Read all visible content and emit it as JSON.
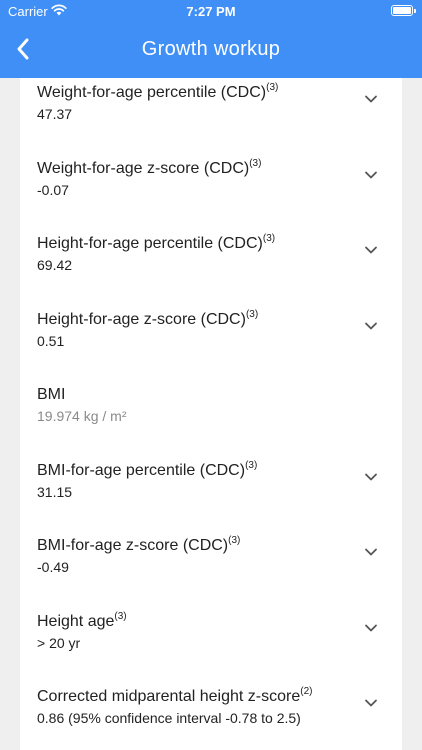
{
  "status_bar": {
    "carrier": "Carrier",
    "time": "7:27 PM",
    "icons": [
      "wifi-icon",
      "battery-icon"
    ]
  },
  "nav": {
    "title": "Growth workup",
    "back_icon": "chevron-left-icon"
  },
  "colors": {
    "header": "#3f8ff7",
    "background": "#efefef",
    "card": "#ffffff"
  },
  "rows": [
    {
      "label": "Weight-for-age percentile (CDC)",
      "ref": "(3)",
      "value": "47.37",
      "expandable": true
    },
    {
      "label": "Weight-for-age z-score (CDC)",
      "ref": "(3)",
      "value": "-0.07",
      "expandable": true
    },
    {
      "label": "Height-for-age percentile (CDC)",
      "ref": "(3)",
      "value": "69.42",
      "expandable": true
    },
    {
      "label": "Height-for-age z-score (CDC)",
      "ref": "(3)",
      "value": "0.51",
      "expandable": true
    },
    {
      "label": "BMI",
      "ref": "",
      "value": "19.974 kg / m²",
      "expandable": false
    },
    {
      "label": "BMI-for-age percentile (CDC)",
      "ref": "(3)",
      "value": "31.15",
      "expandable": true
    },
    {
      "label": "BMI-for-age z-score (CDC)",
      "ref": "(3)",
      "value": "-0.49",
      "expandable": true
    },
    {
      "label": "Height age",
      "ref": "(3)",
      "value": "> 20 yr",
      "expandable": true
    },
    {
      "label": "Corrected midparental height z-score",
      "ref": "(2)",
      "value": "0.86 (95% confidence interval -0.78 to 2.5)",
      "expandable": true
    }
  ]
}
